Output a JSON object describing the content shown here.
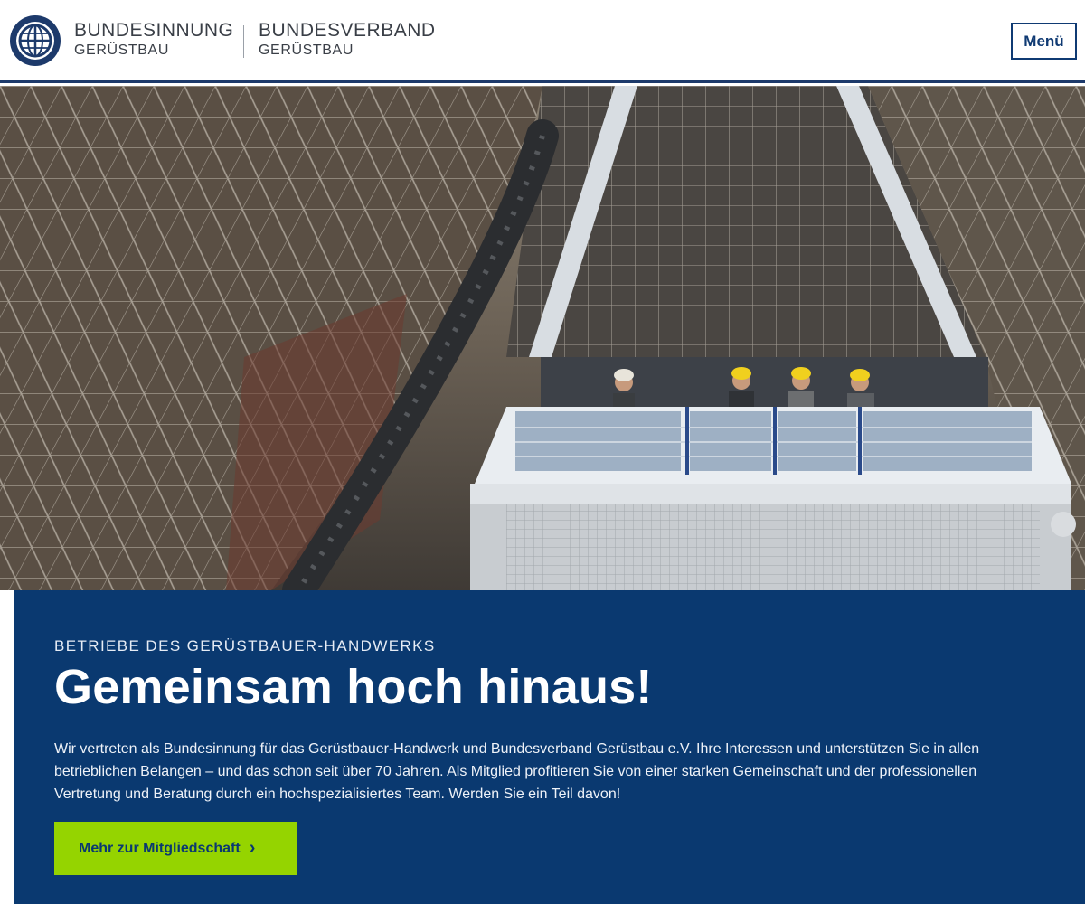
{
  "header": {
    "brand_left_line1": "BUNDESINNUNG",
    "brand_left_line2": "GERÜSTBAU",
    "brand_right_line1": "BUNDESVERBAND",
    "brand_right_line2": "GERÜSTBAU",
    "menu_label": "Menü",
    "logo_icon": "globe-logo-icon"
  },
  "hero": {
    "image_subject": "scaffolding-with-workers-on-lift"
  },
  "main": {
    "eyebrow": "BETRIEBE DES GERÜSTBAUER-HANDWERKS",
    "headline": "Gemeinsam hoch hinaus!",
    "intro": "Wir vertreten als Bundesinnung für das Gerüstbauer-Handwerk und Bundesverband Gerüstbau e.V. Ihre Interessen und unterstützen Sie in allen betrieblichen Belangen – und das schon seit über 70 Jahren. Als Mitglied profitieren Sie von einer starken Gemeinschaft und der professionellen Vertretung und Beratung durch ein hochspezialisiertes Team. Werden Sie ein Teil davon!",
    "cta_label": "Mehr zur Mitgliedschaft",
    "cta_icon": "chevron-right-icon"
  },
  "colors": {
    "navy": "#0a3970",
    "accent_green": "#95d400",
    "header_border": "#1d3a6b"
  }
}
